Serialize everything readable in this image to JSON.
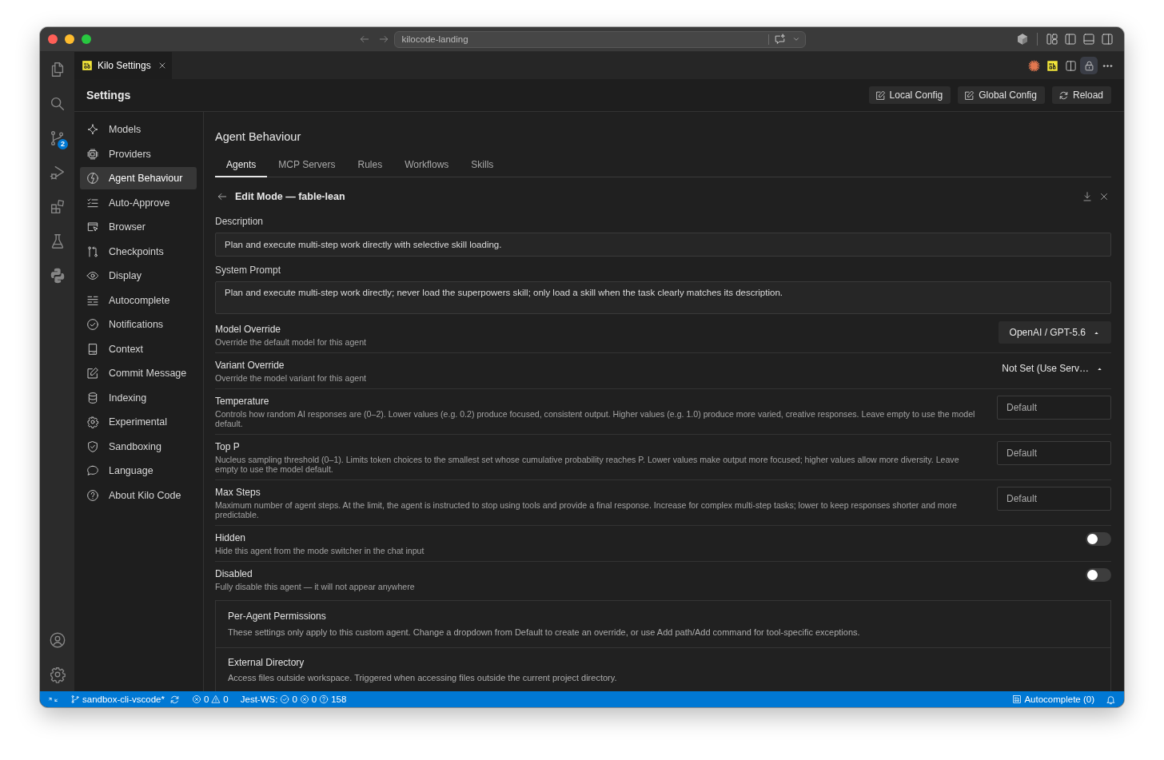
{
  "title_bar": {
    "command_center": "kilocode-landing"
  },
  "activity_bar": {
    "top": [
      {
        "kind": "files"
      },
      {
        "kind": "search"
      },
      {
        "kind": "source-control",
        "badge": "2"
      },
      {
        "kind": "run-debug"
      },
      {
        "kind": "extensions"
      },
      {
        "kind": "testing"
      },
      {
        "kind": "python"
      }
    ],
    "bottom": [
      {
        "kind": "account"
      },
      {
        "kind": "manage"
      }
    ]
  },
  "editor_tabs": [
    {
      "label": "Kilo Settings",
      "selected": true
    }
  ],
  "editor_actions": [
    {
      "kind": "burst",
      "on": false
    },
    {
      "kind": "logo",
      "on": false
    },
    {
      "kind": "split",
      "on": false
    },
    {
      "kind": "lock",
      "on": true
    },
    {
      "kind": "more",
      "on": false
    }
  ],
  "settings": {
    "title": "Settings",
    "actions": [
      {
        "kind": "edit",
        "label": "Local Config"
      },
      {
        "kind": "edit",
        "label": "Global Config"
      },
      {
        "kind": "reload",
        "label": "Reload"
      }
    ],
    "nav": [
      {
        "kind": "sparkle",
        "label": "Models",
        "selected": false
      },
      {
        "kind": "chip",
        "label": "Providers",
        "selected": false
      },
      {
        "kind": "bolt-circle",
        "label": "Agent Behaviour",
        "selected": true
      },
      {
        "kind": "checklist",
        "label": "Auto-Approve",
        "selected": false
      },
      {
        "kind": "browser",
        "label": "Browser",
        "selected": false
      },
      {
        "kind": "compare",
        "label": "Checkpoints",
        "selected": false
      },
      {
        "kind": "eye",
        "label": "Display",
        "selected": false
      },
      {
        "kind": "lines",
        "label": "Autocomplete",
        "selected": false
      },
      {
        "kind": "check-circle",
        "label": "Notifications",
        "selected": false
      },
      {
        "kind": "panel",
        "label": "Context",
        "selected": false
      },
      {
        "kind": "edit",
        "label": "Commit Message",
        "selected": false
      },
      {
        "kind": "database",
        "label": "Indexing",
        "selected": false
      },
      {
        "kind": "gear",
        "label": "Experimental",
        "selected": false
      },
      {
        "kind": "shield",
        "label": "Sandboxing",
        "selected": false
      },
      {
        "kind": "speech",
        "label": "Language",
        "selected": false
      },
      {
        "kind": "question",
        "label": "About Kilo Code",
        "selected": false
      }
    ],
    "page": {
      "title": "Agent Behaviour",
      "tabs": [
        {
          "label": "Agents",
          "selected": true
        },
        {
          "label": "MCP Servers",
          "selected": false
        },
        {
          "label": "Rules",
          "selected": false
        },
        {
          "label": "Workflows",
          "selected": false
        },
        {
          "label": "Skills",
          "selected": false
        }
      ],
      "mode": {
        "title": "Edit Mode — fable-lean",
        "description": {
          "label": "Description",
          "value": "Plan and execute multi-step work directly with selective skill loading."
        },
        "system_prompt": {
          "label": "System Prompt",
          "value": "Plan and execute multi-step work directly; never load the superpowers skill; only load a skill when the task clearly matches its description."
        },
        "options": [
          {
            "kind": "picker",
            "title": "Model Override",
            "description": "Override the default model for this agent",
            "value": "OpenAI / GPT-5.6"
          },
          {
            "kind": "select",
            "title": "Variant Override",
            "description": "Override the model variant for this agent",
            "value": "Not Set (Use Serv…"
          },
          {
            "kind": "number",
            "title": "Temperature",
            "description": "Controls how random AI responses are (0–2). Lower values (e.g. 0.2) produce focused, consistent output. Higher values (e.g. 1.0) produce more varied, creative responses. Leave empty to use the model default.",
            "placeholder": "Default"
          },
          {
            "kind": "number",
            "title": "Top P",
            "description": "Nucleus sampling threshold (0–1). Limits token choices to the smallest set whose cumulative probability reaches P. Lower values make output more focused; higher values allow more diversity. Leave empty to use the model default.",
            "placeholder": "Default"
          },
          {
            "kind": "number",
            "title": "Max Steps",
            "description": "Maximum number of agent steps. At the limit, the agent is instructed to stop using tools and provide a final response. Increase for complex multi-step tasks; lower to keep responses shorter and more predictable.",
            "placeholder": "Default"
          },
          {
            "kind": "toggle",
            "title": "Hidden",
            "description": "Hide this agent from the mode switcher in the chat input",
            "on": false
          },
          {
            "kind": "toggle",
            "title": "Disabled",
            "description": "Fully disable this agent — it will not appear anywhere",
            "on": false
          }
        ],
        "permissions": {
          "title": "Per-Agent Permissions",
          "description": "These settings only apply to this custom agent. Change a dropdown from Default to create an override, or use Add path/Add command for tool-specific exceptions.",
          "items": [
            {
              "title": "External Directory",
              "description": "Access files outside workspace. Triggered when accessing files outside the current project directory."
            }
          ]
        }
      }
    }
  },
  "status_bar": {
    "left": [
      {
        "kind": "remote"
      },
      {
        "kind": "branch",
        "text": "sandbox-cli-vscode*"
      },
      {
        "kind": "sync"
      },
      {
        "kind": "problems",
        "counts": [
          {
            "kind": "error",
            "text": "0"
          },
          {
            "kind": "warning",
            "text": "0"
          }
        ]
      },
      {
        "kind": "tests",
        "label": "Jest-WS:",
        "counts": [
          {
            "kind": "passed",
            "text": "0"
          },
          {
            "kind": "failed",
            "text": "0"
          },
          {
            "kind": "unknown",
            "text": "158"
          }
        ]
      }
    ],
    "right": [
      {
        "kind": "autocomplete",
        "text": "Autocomplete (0)"
      },
      {
        "kind": "notifications"
      }
    ]
  }
}
